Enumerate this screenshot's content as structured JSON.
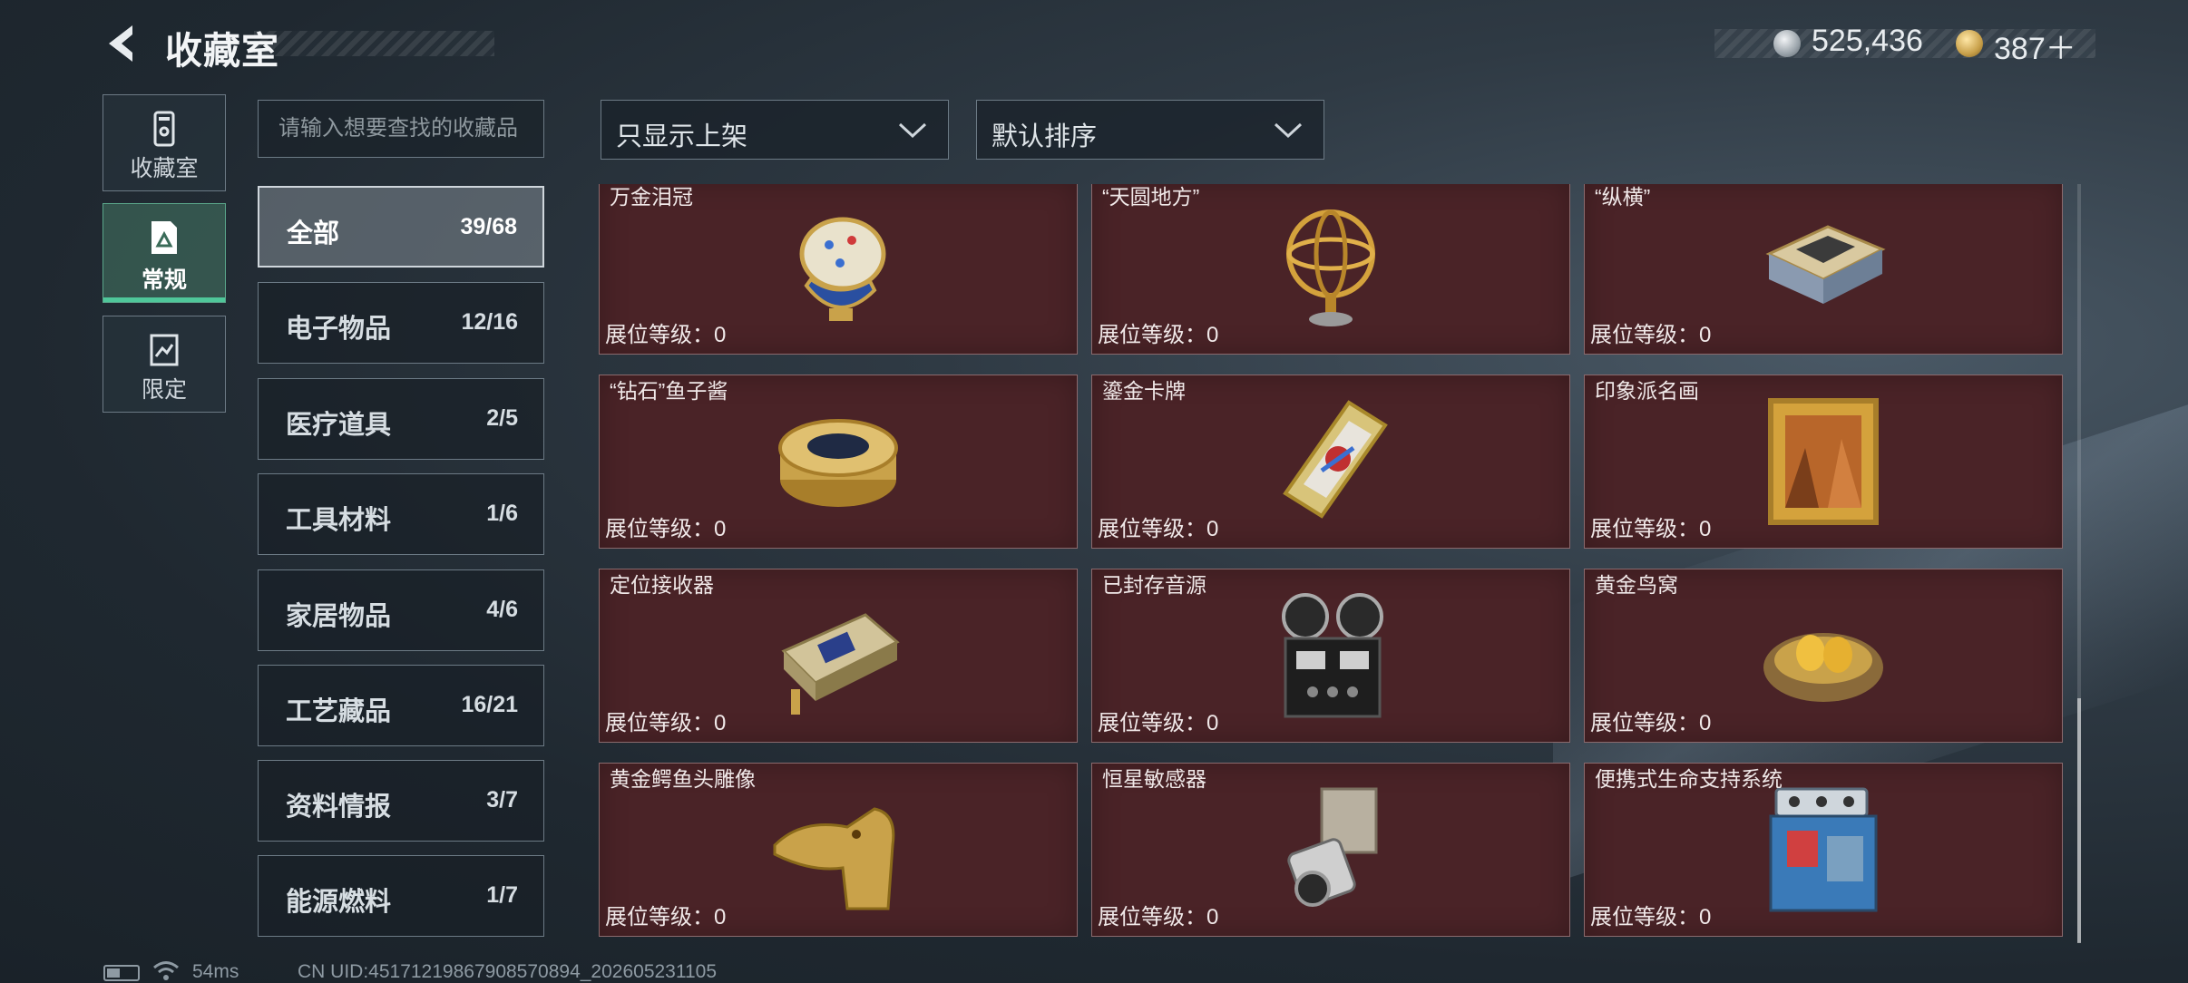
{
  "header": {
    "title": "收藏室",
    "currency": [
      {
        "icon": "silver-coin-icon",
        "value": "525,436"
      },
      {
        "icon": "gold-coin-icon",
        "value": "387＋"
      }
    ]
  },
  "side_nav": [
    {
      "label": "收藏室",
      "icon": "collection-room-icon"
    },
    {
      "label": "常规",
      "icon": "regular-collection-icon",
      "active": true
    },
    {
      "label": "限定",
      "icon": "limited-collection-icon"
    }
  ],
  "search": {
    "placeholder": "请输入想要查找的收藏品",
    "value": ""
  },
  "categories": [
    {
      "name": "全部",
      "count": "39/68",
      "active": true
    },
    {
      "name": "电子物品",
      "count": "12/16"
    },
    {
      "name": "医疗道具",
      "count": "2/5"
    },
    {
      "name": "工具材料",
      "count": "1/6"
    },
    {
      "name": "家居物品",
      "count": "4/6"
    },
    {
      "name": "工艺藏品",
      "count": "16/21"
    },
    {
      "name": "资料情报",
      "count": "3/7"
    },
    {
      "name": "能源燃料",
      "count": "1/7"
    }
  ],
  "filters": {
    "display_filter": "只显示上架",
    "sort": "默认排序"
  },
  "items": [
    {
      "name": "万金泪冠",
      "level": "展位等级：0",
      "icon": "jeweled-egg-icon"
    },
    {
      "name": "“天圆地方”",
      "level": "展位等级：0",
      "icon": "armillary-sphere-icon"
    },
    {
      "name": "“纵横”",
      "level": "展位等级：0",
      "icon": "chess-box-icon"
    },
    {
      "name": "“钻石”鱼子酱",
      "level": "展位等级：0",
      "icon": "caviar-tin-icon"
    },
    {
      "name": "鎏金卡牌",
      "level": "展位等级：0",
      "icon": "gilded-card-icon"
    },
    {
      "name": "印象派名画",
      "level": "展位等级：0",
      "icon": "framed-painting-icon"
    },
    {
      "name": "定位接收器",
      "level": "展位等级：0",
      "icon": "locator-receiver-icon"
    },
    {
      "name": "已封存音源",
      "level": "展位等级：0",
      "icon": "reel-recorder-icon"
    },
    {
      "name": "黄金鸟窝",
      "level": "展位等级：0",
      "icon": "golden-nest-icon"
    },
    {
      "name": "黄金鳄鱼头雕像",
      "level": "展位等级：0",
      "icon": "golden-crocodile-icon"
    },
    {
      "name": "恒星敏感器",
      "level": "展位等级：0",
      "icon": "star-sensor-icon"
    },
    {
      "name": "便携式生命支持系统",
      "level": "展位等级：0",
      "icon": "life-support-icon"
    }
  ],
  "status_bar": {
    "ping": "54ms",
    "uid": "CN UID:4517121986790857089​4_202605231105"
  },
  "colors": {
    "card_bg": "#4a2327",
    "active_accent": "#4fc79a"
  }
}
